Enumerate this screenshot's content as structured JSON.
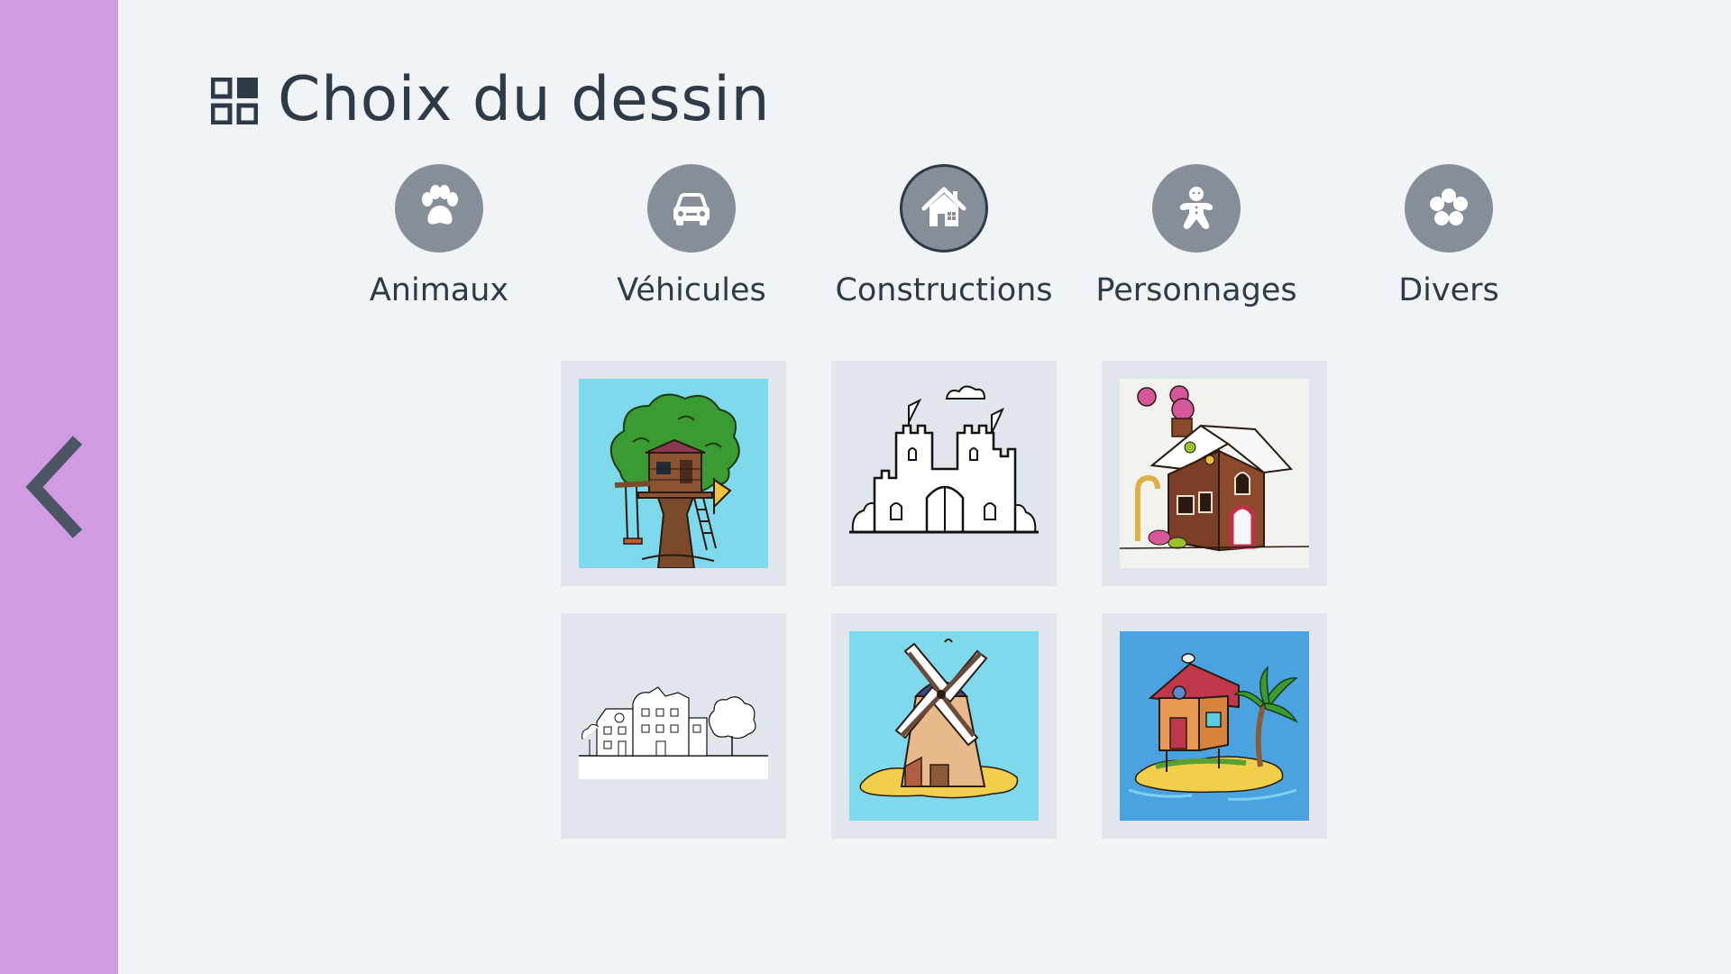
{
  "header": {
    "title": "Choix du dessin",
    "icon": "grid-view-icon"
  },
  "sidebar": {
    "color": "#d19be2",
    "back_icon": "chevron-left-icon"
  },
  "categories": [
    {
      "label": "Animaux",
      "icon": "paw-icon",
      "active": false
    },
    {
      "label": "Véhicules",
      "icon": "car-icon",
      "active": false
    },
    {
      "label": "Constructions",
      "icon": "house-icon",
      "active": true
    },
    {
      "label": "Personnages",
      "icon": "gingerbread-man-icon",
      "active": false
    },
    {
      "label": "Divers",
      "icon": "flower-icon",
      "active": false
    }
  ],
  "drawings": [
    {
      "subject": "treehouse",
      "background": "#7ed9ec",
      "colored": true
    },
    {
      "subject": "castle",
      "background": "#e1e6ec",
      "colored": false
    },
    {
      "subject": "gingerbread-house",
      "background": "#f2f2ee",
      "colored": true
    },
    {
      "subject": "townhouses",
      "background": "#e1e6ec",
      "colored": false
    },
    {
      "subject": "windmill",
      "background": "#7ed9ec",
      "colored": true
    },
    {
      "subject": "island-house",
      "background": "#4aa3e0",
      "colored": true
    }
  ],
  "colors": {
    "background": "#f0f4f7",
    "text": "#2e3a48",
    "category_icon_bg": "#868e99",
    "tile_bg": "#e1e6ec"
  }
}
